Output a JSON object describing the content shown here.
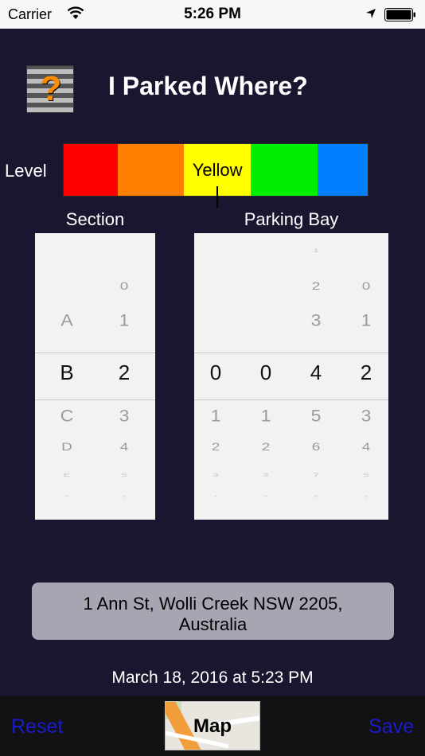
{
  "status_bar": {
    "carrier": "Carrier",
    "time": "5:26 PM"
  },
  "header": {
    "title": "I Parked Where?",
    "icon_glyph": "?"
  },
  "level": {
    "label": "Level",
    "selected": "Yellow",
    "segments": [
      {
        "color": "#ff0000",
        "fraction": 0.177
      },
      {
        "color": "#ff8000",
        "fraction": 0.219
      },
      {
        "color": "#ffff00",
        "fraction": 0.219,
        "label": "Yellow"
      },
      {
        "color": "#00ee00",
        "fraction": 0.219
      },
      {
        "color": "#0080ff",
        "fraction": 0.166
      }
    ]
  },
  "section_picker": {
    "label": "Section",
    "columns": [
      {
        "values": [
          "",
          "",
          "",
          "A",
          "B",
          "C",
          "D",
          "E",
          "F"
        ],
        "selected_index": 4
      },
      {
        "values": [
          "",
          "",
          "0",
          "1",
          "2",
          "3",
          "4",
          "5",
          "6"
        ],
        "selected_index": 4
      }
    ]
  },
  "bay_picker": {
    "label": "Parking Bay",
    "columns": [
      {
        "values": [
          "",
          "",
          "",
          "",
          "0",
          "1",
          "2",
          "3",
          "4"
        ],
        "selected_index": 4
      },
      {
        "values": [
          "",
          "",
          "",
          "",
          "0",
          "1",
          "2",
          "3",
          "4"
        ],
        "selected_index": 4
      },
      {
        "values": [
          "0",
          "1",
          "2",
          "3",
          "4",
          "5",
          "6",
          "7",
          "8"
        ],
        "selected_index": 4
      },
      {
        "values": [
          "",
          "",
          "0",
          "1",
          "2",
          "3",
          "4",
          "5",
          "6"
        ],
        "selected_index": 4
      }
    ]
  },
  "address": {
    "line1": "1 Ann St, Wolli Creek NSW 2205,",
    "line2": "Australia"
  },
  "timestamp": "March 18, 2016 at 5:23 PM",
  "toolbar": {
    "reset_label": "Reset",
    "map_label": "Map",
    "save_label": "Save"
  }
}
